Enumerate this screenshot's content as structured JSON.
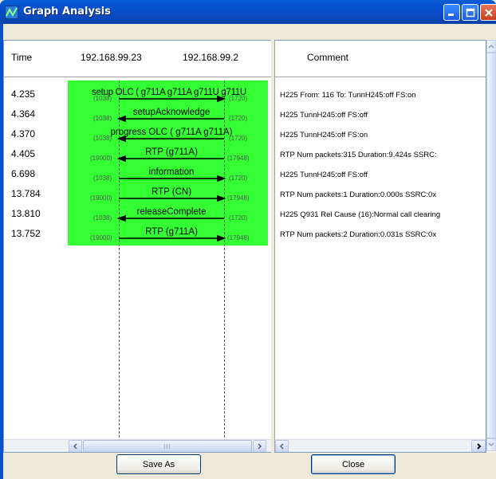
{
  "window": {
    "title": "Graph Analysis",
    "accent": "#0553d0"
  },
  "columns": {
    "time": "Time",
    "node_a": "192.168.99.23",
    "node_b": "192.168.99.2",
    "comment": "Comment"
  },
  "rows": [
    {
      "time": "4.235",
      "label": "setup OLC ( g711A g711A g711U g711U",
      "port_a": "(1038)",
      "port_b": "(1720)",
      "comment": "H225 From: 116 To:  TunnH245:off FS:on"
    },
    {
      "time": "4.364",
      "label": "setupAcknowledge",
      "port_a": "(1038)",
      "port_b": "(1720)",
      "comment": "H225 TunnH245:off FS:off"
    },
    {
      "time": "4.370",
      "label": "progress OLC ( g711A g711A)",
      "port_a": "(1038)",
      "port_b": "(1720)",
      "comment": "H225 TunnH245:off FS:on"
    },
    {
      "time": "4.405",
      "label": "RTP (g711A)",
      "port_a": "(19000)",
      "port_b": "(17948)",
      "comment": "RTP Num packets:315  Duration:9.424s SSRC:"
    },
    {
      "time": "6.698",
      "label": "information",
      "port_a": "(1038)",
      "port_b": "(1720)",
      "comment": "H225 TunnH245:off FS:off"
    },
    {
      "time": "13.784",
      "label": "RTP (CN)",
      "port_a": "(19000)",
      "port_b": "(17948)",
      "comment": "RTP Num packets:1  Duration:0.000s SSRC:0x"
    },
    {
      "time": "13.810",
      "label": "releaseComplete",
      "port_a": "(1038)",
      "port_b": "(1720)",
      "comment": "H225 Q931 Rel Cause (16):Normal call clearing"
    },
    {
      "time": "13.752",
      "label": "RTP (g711A)",
      "port_a": "(19000)",
      "port_b": "(17948)",
      "comment": "RTP Num packets:2  Duration:0.031s SSRC:0x"
    }
  ],
  "arrows": [
    "right",
    "left",
    "left",
    "left",
    "right",
    "right",
    "left",
    "right"
  ],
  "scroll": {
    "thumb_glyph": "III"
  },
  "buttons": {
    "save_as": "Save As",
    "close": "Close"
  },
  "colors": {
    "highlight": "#33ff33"
  }
}
